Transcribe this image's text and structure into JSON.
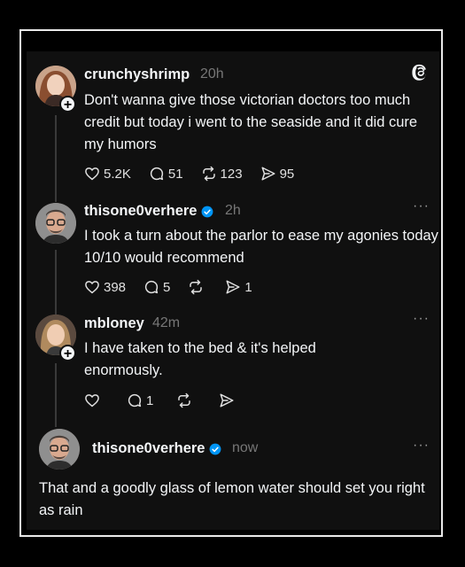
{
  "posts": [
    {
      "username": "crunchyshrimp",
      "time": "20h",
      "text": "Don't wanna give those victorian doctors too much credit but today i went to the seaside and it did cure my humors",
      "likes": "5.2K",
      "replies": "51",
      "reposts": "123",
      "shares": "95"
    },
    {
      "username": "thisone0verhere",
      "time": "2h",
      "text": "I took a turn about the parlor to ease my agonies today 10/10 would recommend",
      "likes": "398",
      "replies": "5",
      "reposts": "",
      "shares": "1"
    },
    {
      "username": "mbloney",
      "time": "42m",
      "text": "I have taken to the bed & it's helped enormously.",
      "likes": "",
      "replies": "1",
      "reposts": "",
      "shares": ""
    },
    {
      "username": "thisone0verhere",
      "time": "now",
      "text": "That and a goodly glass of lemon water should set you right as rain"
    }
  ],
  "icons": {
    "app_logo": "threads-logo-icon",
    "more": "more-icon",
    "verified": "verified-badge-icon"
  },
  "colors": {
    "background": "#101010",
    "text": "#f3f5f7",
    "muted": "#777777",
    "verified": "#0095f6"
  }
}
